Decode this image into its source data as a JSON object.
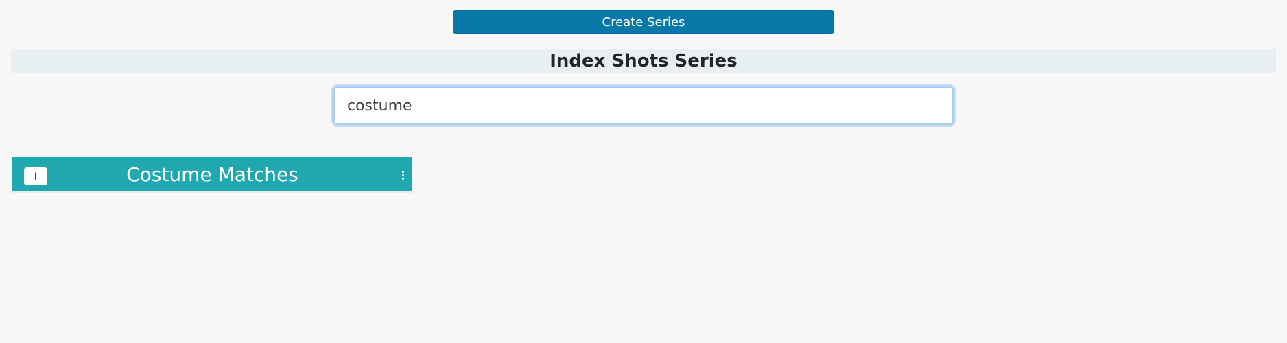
{
  "toolbar": {
    "create_label": "Create Series"
  },
  "header": {
    "title": "Index Shots Series"
  },
  "search": {
    "value": "costume"
  },
  "series": [
    {
      "badge": "I",
      "title": "Costume Matches",
      "menu_icon": "vertical-ellipsis-icon"
    }
  ],
  "colors": {
    "page_bg": "#f7f7f7",
    "primary_button": "#0878a8",
    "title_bar_bg": "#e8eff0",
    "card_bg": "#1fa8b0",
    "focus_ring": "#a9cdf0"
  }
}
